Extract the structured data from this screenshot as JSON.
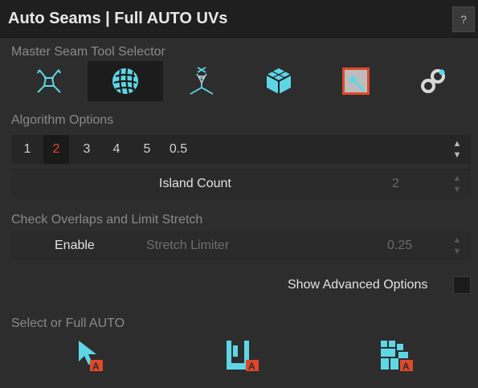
{
  "window": {
    "title": "Auto Seams | Full AUTO UVs",
    "help_label": "?"
  },
  "sections": {
    "master_seam": "Master Seam Tool Selector",
    "algorithm": "Algorithm Options",
    "overlaps": "Check Overlaps and Limit Stretch",
    "select": "Select or Full AUTO"
  },
  "tools": [
    {
      "icon": "character-uv-icon",
      "active": false
    },
    {
      "icon": "sphere-uv-icon",
      "active": true
    },
    {
      "icon": "figure-uv-icon",
      "active": false
    },
    {
      "icon": "cube-uv-icon",
      "active": false
    },
    {
      "icon": "selection-square-icon",
      "active": false
    },
    {
      "icon": "link-chain-icon",
      "active": false
    }
  ],
  "algorithm": {
    "options": [
      "1",
      "2",
      "3",
      "4",
      "5",
      "0.5"
    ],
    "selected": "2"
  },
  "island": {
    "label": "Island Count",
    "value": "2"
  },
  "stretch": {
    "enable_label": "Enable",
    "label": "Stretch Limiter",
    "value": "0.25"
  },
  "advanced": {
    "label": "Show Advanced Options",
    "checked": false
  },
  "bottom_buttons": [
    "select-auto-icon",
    "unwrap-auto-icon",
    "pack-auto-icon"
  ],
  "colors": {
    "accent": "#e0482a",
    "icon": "#5ed6e6",
    "panel": "#2d2d2d"
  }
}
